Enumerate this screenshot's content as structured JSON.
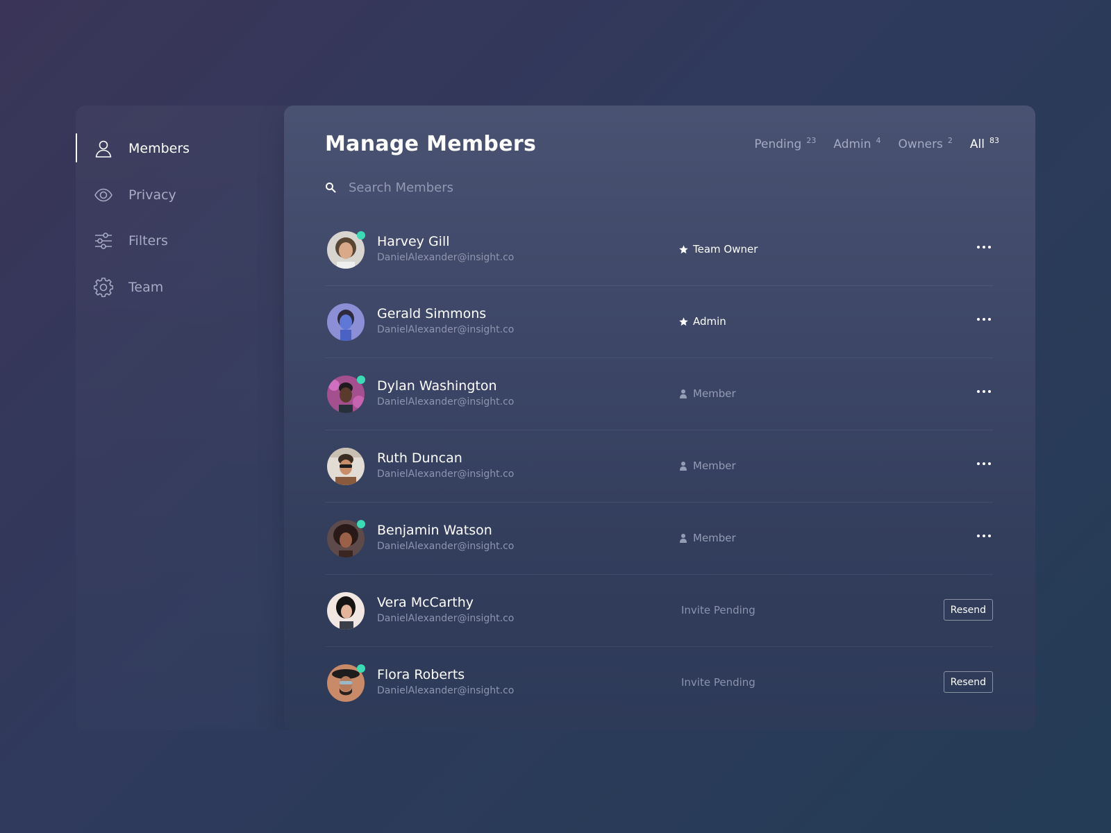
{
  "sidebar": {
    "items": [
      {
        "label": "Members",
        "icon": "user-icon",
        "active": true
      },
      {
        "label": "Privacy",
        "icon": "eye-icon",
        "active": false
      },
      {
        "label": "Filters",
        "icon": "sliders-icon",
        "active": false
      },
      {
        "label": "Team",
        "icon": "gear-icon",
        "active": false
      }
    ]
  },
  "header": {
    "title": "Manage Members",
    "tabs": [
      {
        "label": "Pending",
        "count": "23",
        "active": false
      },
      {
        "label": "Admin",
        "count": "4",
        "active": false
      },
      {
        "label": "Owners",
        "count": "2",
        "active": false
      },
      {
        "label": "All",
        "count": "83",
        "active": true
      }
    ]
  },
  "search": {
    "placeholder": "Search Members",
    "value": ""
  },
  "members": [
    {
      "name": "Harvey Gill",
      "email": "DanielAlexander@insight.co",
      "role": "Team Owner",
      "role_icon": "star-icon",
      "online": true,
      "action": "more"
    },
    {
      "name": "Gerald Simmons",
      "email": "DanielAlexander@insight.co",
      "role": "Admin",
      "role_icon": "star-icon",
      "online": false,
      "action": "more"
    },
    {
      "name": "Dylan Washington",
      "email": "DanielAlexander@insight.co",
      "role": "Member",
      "role_icon": "person-icon",
      "online": true,
      "action": "more"
    },
    {
      "name": "Ruth Duncan",
      "email": "DanielAlexander@insight.co",
      "role": "Member",
      "role_icon": "person-icon",
      "online": false,
      "action": "more"
    },
    {
      "name": "Benjamin Watson",
      "email": "DanielAlexander@insight.co",
      "role": "Member",
      "role_icon": "person-icon",
      "online": true,
      "action": "more"
    },
    {
      "name": "Vera McCarthy",
      "email": "DanielAlexander@insight.co",
      "role": "Invite Pending",
      "role_icon": "",
      "online": false,
      "action": "resend"
    },
    {
      "name": "Flora Roberts",
      "email": "DanielAlexander@insight.co",
      "role": "Invite Pending",
      "role_icon": "",
      "online": true,
      "action": "resend"
    }
  ],
  "actions": {
    "resend_label": "Resend"
  },
  "colors": {
    "online": "#3ddbb5",
    "background_start": "#3a3558",
    "background_end": "#243c55"
  }
}
